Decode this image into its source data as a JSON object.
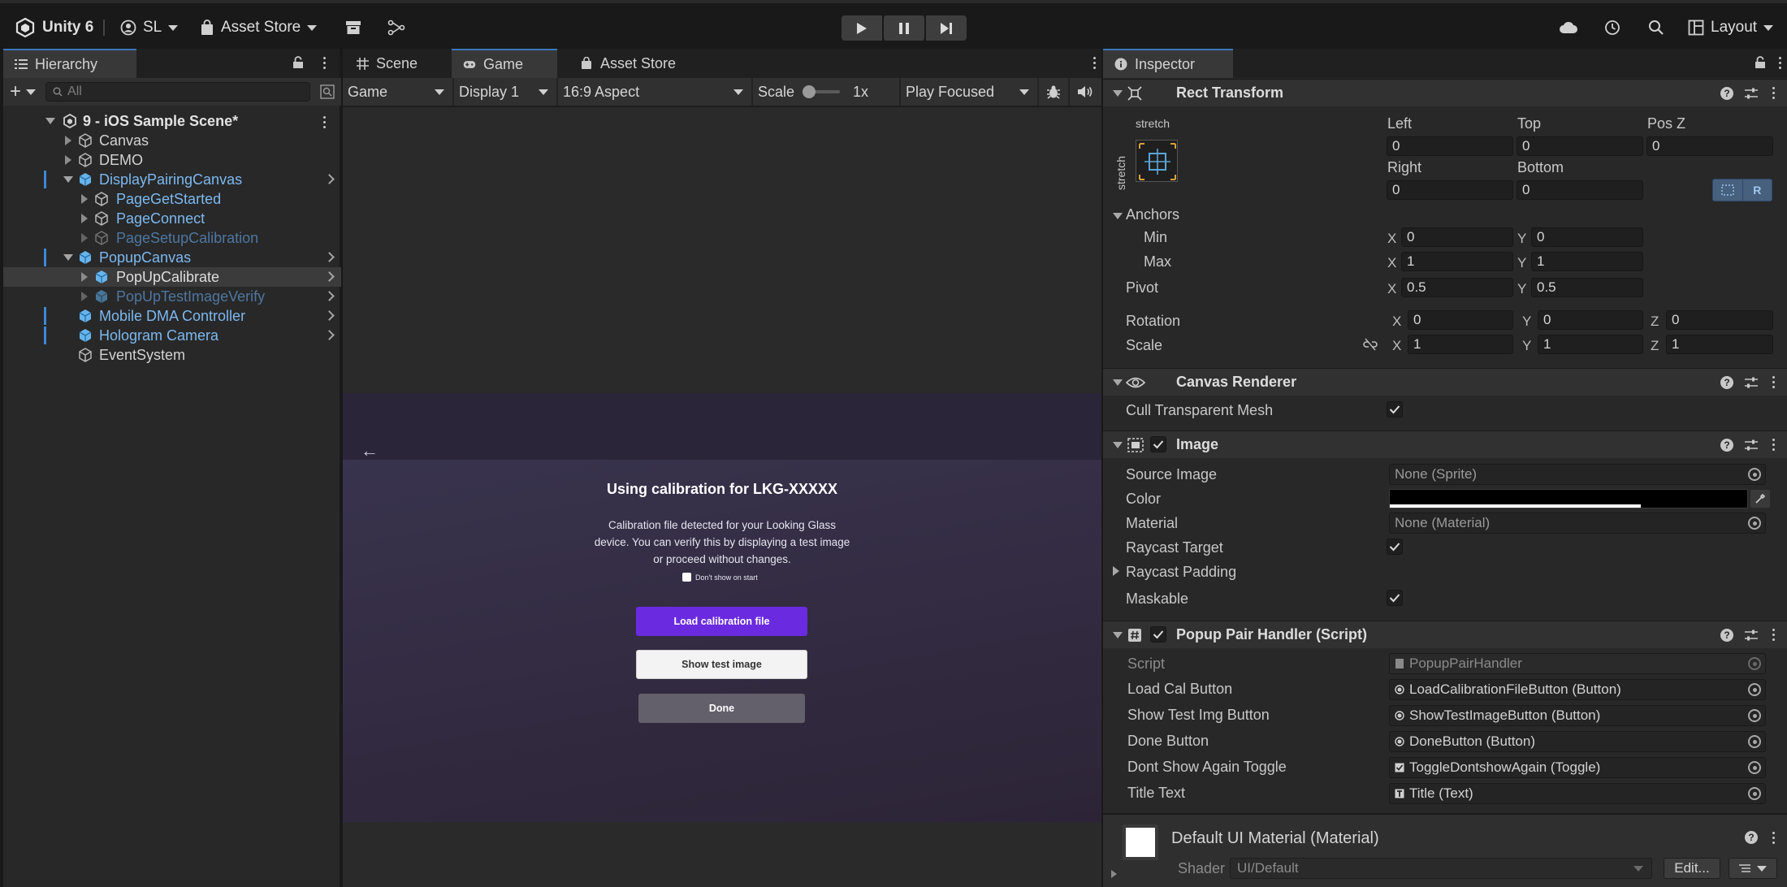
{
  "toolbar": {
    "app_name": "Unity 6",
    "account": "SL",
    "asset_store": "Asset Store",
    "layout": "Layout"
  },
  "hierarchy": {
    "tab_label": "Hierarchy",
    "search_placeholder": "All",
    "scene_name": "9 - iOS Sample Scene*",
    "items": [
      {
        "label": "Canvas"
      },
      {
        "label": "DEMO"
      },
      {
        "label": "DisplayPairingCanvas"
      },
      {
        "label": "PageGetStarted"
      },
      {
        "label": "PageConnect"
      },
      {
        "label": "PageSetupCalibration"
      },
      {
        "label": "PopupCanvas"
      },
      {
        "label": "PopUpCalibrate"
      },
      {
        "label": "PopUpTestImageVerify"
      },
      {
        "label": "Mobile DMA Controller"
      },
      {
        "label": "Hologram Camera"
      },
      {
        "label": "EventSystem"
      }
    ]
  },
  "center_tabs": {
    "scene": "Scene",
    "game": "Game",
    "asset_store": "Asset Store"
  },
  "game_options": {
    "view": "Game",
    "display": "Display 1",
    "aspect": "16:9 Aspect",
    "scale_label": "Scale",
    "scale_value": "1x",
    "play_mode": "Play Focused"
  },
  "game_content": {
    "back_arrow": "←",
    "title": "Using calibration for LKG-XXXXX",
    "body_lines": [
      "Calibration file detected for your Looking Glass",
      "device. You can verify this by displaying a test image",
      "or proceed without changes."
    ],
    "toggle_label": "Don't show on start",
    "load_button": "Load calibration file",
    "test_button": "Show test image",
    "done_button": "Done",
    "accent_color": "#6a2be0"
  },
  "inspector": {
    "tab_label": "Inspector",
    "rect_transform": {
      "title": "Rect Transform",
      "stretch_top": "stretch",
      "stretch_side": "stretch",
      "left_label": "Left",
      "left": "0",
      "top_label": "Top",
      "top": "0",
      "posz_label": "Pos Z",
      "posz": "0",
      "right_label": "Right",
      "right": "0",
      "bottom_label": "Bottom",
      "bottom": "0",
      "anchors_label": "Anchors",
      "min_label": "Min",
      "min_x": "0",
      "min_y": "0",
      "max_label": "Max",
      "max_x": "1",
      "max_y": "1",
      "pivot_label": "Pivot",
      "pivot_x": "0.5",
      "pivot_y": "0.5",
      "rotation_label": "Rotation",
      "rot_x": "0",
      "rot_y": "0",
      "rot_z": "0",
      "scale_label": "Scale",
      "scale_x": "1",
      "scale_y": "1",
      "scale_z": "1"
    },
    "canvas_renderer": {
      "title": "Canvas Renderer",
      "cull_label": "Cull Transparent Mesh"
    },
    "image": {
      "title": "Image",
      "source_label": "Source Image",
      "source_value": "None (Sprite)",
      "color_label": "Color",
      "material_label": "Material",
      "material_value": "None (Material)",
      "raycast_label": "Raycast Target",
      "padding_label": "Raycast Padding",
      "maskable_label": "Maskable"
    },
    "script": {
      "title": "Popup Pair Handler (Script)",
      "script_label": "Script",
      "script_value": "PopupPairHandler",
      "load_label": "Load Cal Button",
      "load_value": "LoadCalibrationFileButton (Button)",
      "show_label": "Show Test Img Button",
      "show_value": "ShowTestImageButton (Button)",
      "done_label": "Done Button",
      "done_value": "DoneButton (Button)",
      "dont_label": "Dont Show Again Toggle",
      "dont_value": "ToggleDontshowAgain (Toggle)",
      "title_label": "Title Text",
      "title_value": "Title (Text)"
    },
    "material": {
      "title": "Default UI Material (Material)",
      "shader_label": "Shader",
      "shader_value": "UI/Default",
      "edit_button": "Edit..."
    }
  }
}
